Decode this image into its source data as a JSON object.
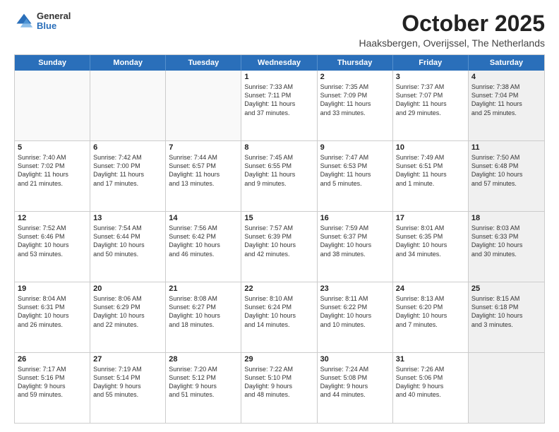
{
  "header": {
    "logo_general": "General",
    "logo_blue": "Blue",
    "month_title": "October 2025",
    "location": "Haaksbergen, Overijssel, The Netherlands"
  },
  "weekdays": [
    "Sunday",
    "Monday",
    "Tuesday",
    "Wednesday",
    "Thursday",
    "Friday",
    "Saturday"
  ],
  "rows": [
    [
      {
        "day": "",
        "text": "",
        "empty": true
      },
      {
        "day": "",
        "text": "",
        "empty": true
      },
      {
        "day": "",
        "text": "",
        "empty": true
      },
      {
        "day": "1",
        "text": "Sunrise: 7:33 AM\nSunset: 7:11 PM\nDaylight: 11 hours\nand 37 minutes."
      },
      {
        "day": "2",
        "text": "Sunrise: 7:35 AM\nSunset: 7:09 PM\nDaylight: 11 hours\nand 33 minutes."
      },
      {
        "day": "3",
        "text": "Sunrise: 7:37 AM\nSunset: 7:07 PM\nDaylight: 11 hours\nand 29 minutes."
      },
      {
        "day": "4",
        "text": "Sunrise: 7:38 AM\nSunset: 7:04 PM\nDaylight: 11 hours\nand 25 minutes.",
        "shaded": true
      }
    ],
    [
      {
        "day": "5",
        "text": "Sunrise: 7:40 AM\nSunset: 7:02 PM\nDaylight: 11 hours\nand 21 minutes."
      },
      {
        "day": "6",
        "text": "Sunrise: 7:42 AM\nSunset: 7:00 PM\nDaylight: 11 hours\nand 17 minutes."
      },
      {
        "day": "7",
        "text": "Sunrise: 7:44 AM\nSunset: 6:57 PM\nDaylight: 11 hours\nand 13 minutes."
      },
      {
        "day": "8",
        "text": "Sunrise: 7:45 AM\nSunset: 6:55 PM\nDaylight: 11 hours\nand 9 minutes."
      },
      {
        "day": "9",
        "text": "Sunrise: 7:47 AM\nSunset: 6:53 PM\nDaylight: 11 hours\nand 5 minutes."
      },
      {
        "day": "10",
        "text": "Sunrise: 7:49 AM\nSunset: 6:51 PM\nDaylight: 11 hours\nand 1 minute."
      },
      {
        "day": "11",
        "text": "Sunrise: 7:50 AM\nSunset: 6:48 PM\nDaylight: 10 hours\nand 57 minutes.",
        "shaded": true
      }
    ],
    [
      {
        "day": "12",
        "text": "Sunrise: 7:52 AM\nSunset: 6:46 PM\nDaylight: 10 hours\nand 53 minutes."
      },
      {
        "day": "13",
        "text": "Sunrise: 7:54 AM\nSunset: 6:44 PM\nDaylight: 10 hours\nand 50 minutes."
      },
      {
        "day": "14",
        "text": "Sunrise: 7:56 AM\nSunset: 6:42 PM\nDaylight: 10 hours\nand 46 minutes."
      },
      {
        "day": "15",
        "text": "Sunrise: 7:57 AM\nSunset: 6:39 PM\nDaylight: 10 hours\nand 42 minutes."
      },
      {
        "day": "16",
        "text": "Sunrise: 7:59 AM\nSunset: 6:37 PM\nDaylight: 10 hours\nand 38 minutes."
      },
      {
        "day": "17",
        "text": "Sunrise: 8:01 AM\nSunset: 6:35 PM\nDaylight: 10 hours\nand 34 minutes."
      },
      {
        "day": "18",
        "text": "Sunrise: 8:03 AM\nSunset: 6:33 PM\nDaylight: 10 hours\nand 30 minutes.",
        "shaded": true
      }
    ],
    [
      {
        "day": "19",
        "text": "Sunrise: 8:04 AM\nSunset: 6:31 PM\nDaylight: 10 hours\nand 26 minutes."
      },
      {
        "day": "20",
        "text": "Sunrise: 8:06 AM\nSunset: 6:29 PM\nDaylight: 10 hours\nand 22 minutes."
      },
      {
        "day": "21",
        "text": "Sunrise: 8:08 AM\nSunset: 6:27 PM\nDaylight: 10 hours\nand 18 minutes."
      },
      {
        "day": "22",
        "text": "Sunrise: 8:10 AM\nSunset: 6:24 PM\nDaylight: 10 hours\nand 14 minutes."
      },
      {
        "day": "23",
        "text": "Sunrise: 8:11 AM\nSunset: 6:22 PM\nDaylight: 10 hours\nand 10 minutes."
      },
      {
        "day": "24",
        "text": "Sunrise: 8:13 AM\nSunset: 6:20 PM\nDaylight: 10 hours\nand 7 minutes."
      },
      {
        "day": "25",
        "text": "Sunrise: 8:15 AM\nSunset: 6:18 PM\nDaylight: 10 hours\nand 3 minutes.",
        "shaded": true
      }
    ],
    [
      {
        "day": "26",
        "text": "Sunrise: 7:17 AM\nSunset: 5:16 PM\nDaylight: 9 hours\nand 59 minutes."
      },
      {
        "day": "27",
        "text": "Sunrise: 7:19 AM\nSunset: 5:14 PM\nDaylight: 9 hours\nand 55 minutes."
      },
      {
        "day": "28",
        "text": "Sunrise: 7:20 AM\nSunset: 5:12 PM\nDaylight: 9 hours\nand 51 minutes."
      },
      {
        "day": "29",
        "text": "Sunrise: 7:22 AM\nSunset: 5:10 PM\nDaylight: 9 hours\nand 48 minutes."
      },
      {
        "day": "30",
        "text": "Sunrise: 7:24 AM\nSunset: 5:08 PM\nDaylight: 9 hours\nand 44 minutes."
      },
      {
        "day": "31",
        "text": "Sunrise: 7:26 AM\nSunset: 5:06 PM\nDaylight: 9 hours\nand 40 minutes."
      },
      {
        "day": "",
        "text": "",
        "empty": true,
        "shaded": true
      }
    ]
  ]
}
